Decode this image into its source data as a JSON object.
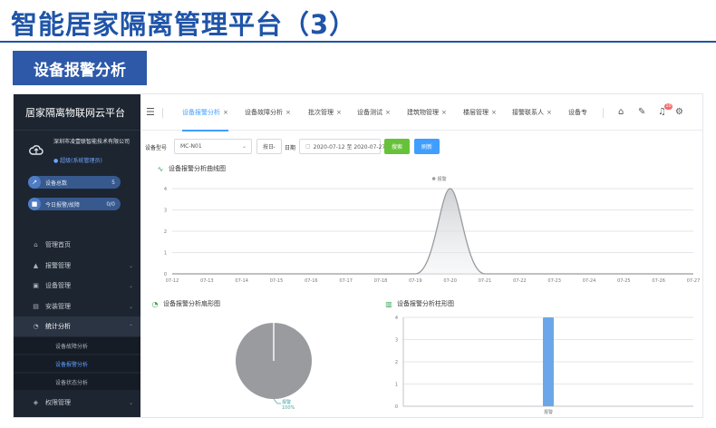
{
  "slide": {
    "title": "智能居家隔离管理平台（3）",
    "badge": "设备报警分析"
  },
  "sidebar": {
    "brand": "居家隔离物联网云平台",
    "company": "深圳市凌壹联智能技术有限公司",
    "role": "● 超级(系统管理员)",
    "stats": [
      {
        "label": "设备总数",
        "value": "5",
        "icon": "trend-icon"
      },
      {
        "label": "今日报警/故障",
        "value": "0/0",
        "icon": "lock-icon"
      }
    ],
    "menu": [
      {
        "label": "管理首页",
        "icon": "home-icon"
      },
      {
        "label": "报警管理",
        "icon": "alarm-icon"
      },
      {
        "label": "设备管理",
        "icon": "device-icon"
      },
      {
        "label": "安装管理",
        "icon": "install-icon"
      },
      {
        "label": "统计分析",
        "icon": "chart-icon"
      },
      {
        "label": "权限管理",
        "icon": "shield-icon"
      }
    ],
    "submenu": [
      "设备故障分析",
      "设备报警分析",
      "设备状态分析"
    ]
  },
  "tabs": {
    "items": [
      "设备报警分析",
      "设备故障分析",
      "批次管理",
      "设备测试",
      "建筑物管理",
      "楼层管理",
      "接警联系人",
      "设备专"
    ],
    "notification_count": "10"
  },
  "filters": {
    "device_type_label": "设备型号",
    "device_type_value": "MC-N01",
    "period_value": "按日",
    "date_label": "日期",
    "date_value": "2020-07-12 至 2020-07-27",
    "search_label": "搜索",
    "refresh_label": "刷新"
  },
  "colors": {
    "sidebar_bg": "#1d2530",
    "accent": "#409eff",
    "search_button": "#67c23a",
    "bar": "#6ba7e8",
    "pie": "#999b9f"
  },
  "chart_data": [
    {
      "type": "area",
      "title": "设备报警分析曲线图",
      "legend": "报警",
      "x": [
        "07-12",
        "07-13",
        "07-14",
        "07-15",
        "07-16",
        "07-17",
        "07-18",
        "07-19",
        "07-20",
        "07-21",
        "07-22",
        "07-23",
        "07-24",
        "07-25",
        "07-26",
        "07-27"
      ],
      "values": [
        0,
        0,
        0,
        0,
        0,
        0,
        0,
        0,
        4,
        0,
        0,
        0,
        0,
        0,
        0,
        0
      ],
      "ylim": [
        0,
        4
      ],
      "yticks": [
        0,
        1,
        2,
        3,
        4
      ],
      "grid": true
    },
    {
      "type": "pie",
      "title": "设备报警分析扇形图",
      "slices": [
        {
          "label": "报警",
          "value": 100,
          "percent": "100%"
        }
      ]
    },
    {
      "type": "bar",
      "title": "设备报警分析柱形图",
      "categories": [
        "报警"
      ],
      "values": [
        4
      ],
      "ylim": [
        0,
        4
      ],
      "yticks": [
        0,
        1,
        2,
        3,
        4
      ]
    }
  ]
}
